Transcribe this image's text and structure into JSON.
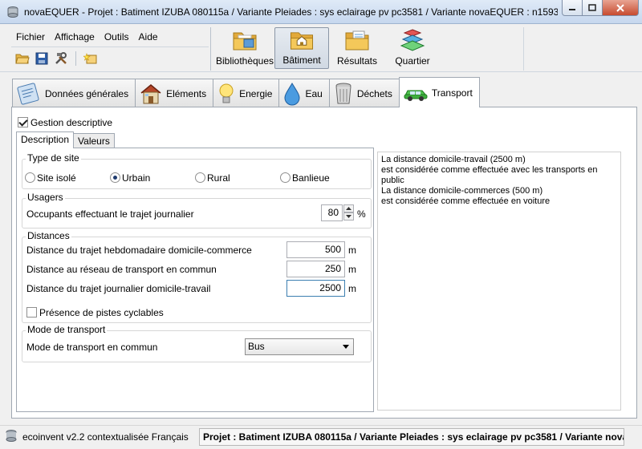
{
  "window": {
    "title": "novaEQUER -  Projet : Batiment IZUBA 080115a / Variante Pleiades : sys eclairage pv pc3581 / Variante novaEQUER : n1593"
  },
  "menu": [
    "Fichier",
    "Affichage",
    "Outils",
    "Aide"
  ],
  "toolbar_icons": [
    "open-folder-icon",
    "save-icon",
    "tools-icon",
    "new-item-icon"
  ],
  "nav": [
    {
      "label": "Bibliothèques",
      "icon": "library-folder-icon",
      "active": false
    },
    {
      "label": "Bâtiment",
      "icon": "building-folder-icon",
      "active": true
    },
    {
      "label": "Résultats",
      "icon": "results-folder-icon",
      "active": false
    },
    {
      "label": "Quartier",
      "icon": "district-layers-icon",
      "active": false
    }
  ],
  "tabs": [
    {
      "label": "Données générales",
      "icon": "general-data-icon"
    },
    {
      "label": "Eléments",
      "icon": "house-icon"
    },
    {
      "label": "Energie",
      "icon": "lightbulb-icon"
    },
    {
      "label": "Eau",
      "icon": "water-drop-icon"
    },
    {
      "label": "Déchets",
      "icon": "trash-bin-icon"
    },
    {
      "label": "Transport",
      "icon": "car-icon"
    }
  ],
  "active_tab": "Transport",
  "gestion_descriptive": {
    "label": "Gestion descriptive",
    "checked": true
  },
  "subtabs": [
    "Description",
    "Valeurs"
  ],
  "type_site": {
    "title": "Type de site",
    "options": [
      "Site isolé",
      "Urbain",
      "Rural",
      "Banlieue"
    ],
    "selected": "Urbain"
  },
  "usagers": {
    "title": "Usagers",
    "label": "Occupants effectuant le trajet journalier",
    "value": "80",
    "unit": "%"
  },
  "distances": {
    "title": "Distances",
    "rows": [
      {
        "label": "Distance du trajet hebdomadaire domicile-commerce",
        "value": "500",
        "unit": "m"
      },
      {
        "label": "Distance au réseau de transport en commun",
        "value": "250",
        "unit": "m"
      },
      {
        "label": "Distance du trajet journalier domicile-travail",
        "value": "2500",
        "unit": "m"
      }
    ],
    "pistes": {
      "label": "Présence de pistes cyclables",
      "checked": false
    }
  },
  "mode_transport": {
    "title": "Mode de transport",
    "label": "Mode de transport en commun",
    "value": "Bus"
  },
  "info": [
    "La distance domicile-travail (2500 m)",
    "est considérée comme effectuée avec les transports en",
    "public",
    "La distance domicile-commerces (500 m)",
    "est considérée comme effectuée en voiture"
  ],
  "status": {
    "left": "ecoinvent v2.2 contextualisée Français",
    "right": "Projet : Batiment IZUBA 080115a / Variante Pleiades : sys eclairage pv pc3581 / Variante novaEQUER :"
  }
}
